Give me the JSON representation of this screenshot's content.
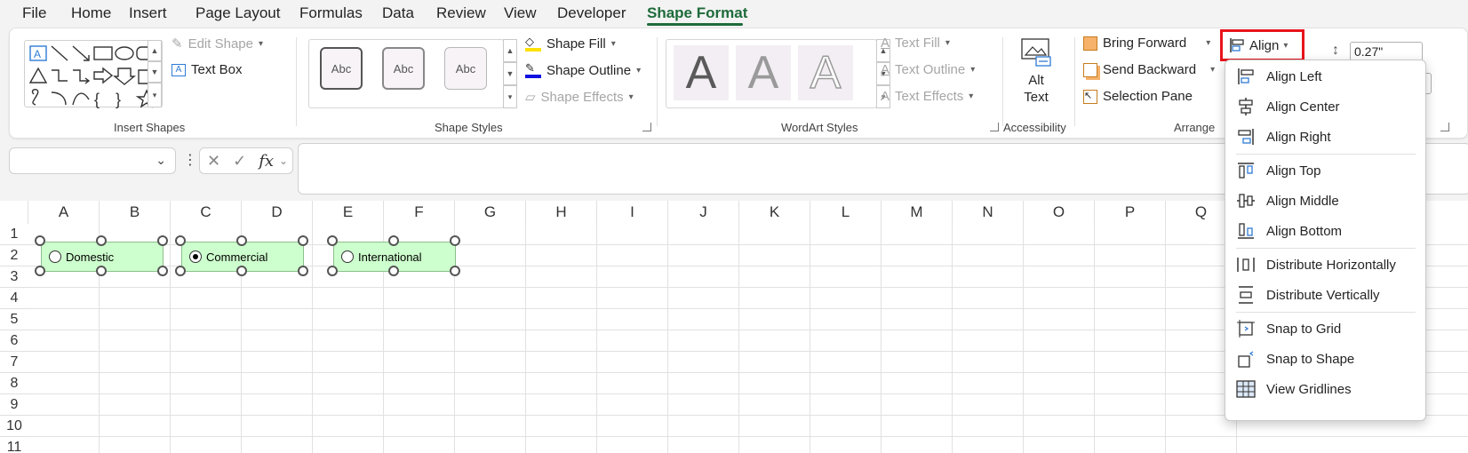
{
  "tabs": [
    "File",
    "Home",
    "Insert",
    "Page Layout",
    "Formulas",
    "Data",
    "Review",
    "View",
    "Developer",
    "Shape Format"
  ],
  "active_tab": "Shape Format",
  "ribbon": {
    "insert_shapes": {
      "edit_shape": "Edit Shape",
      "text_box": "Text Box",
      "label": "Insert Shapes"
    },
    "shape_styles": {
      "sample_label": "Abc",
      "shape_fill": "Shape Fill",
      "shape_outline": "Shape Outline",
      "shape_effects": "Shape Effects",
      "label": "Shape Styles"
    },
    "wordart": {
      "letter": "A",
      "text_fill": "Text Fill",
      "text_outline": "Text Outline",
      "text_effects": "Text Effects",
      "label": "WordArt Styles"
    },
    "accessibility": {
      "alt_text_line1": "Alt",
      "alt_text_line2": "Text",
      "label": "Accessibility"
    },
    "arrange": {
      "bring_forward": "Bring Forward",
      "send_backward": "Send Backward",
      "selection_pane": "Selection Pane",
      "align": "Align",
      "label": "Arrange"
    },
    "size": {
      "height": "0.27\""
    }
  },
  "formula_bar": {
    "fx": "fx",
    "cancel": "✕",
    "enter": "✓"
  },
  "columns": [
    "A",
    "B",
    "C",
    "D",
    "E",
    "F",
    "G",
    "H",
    "I",
    "J",
    "K",
    "L",
    "M",
    "N",
    "O",
    "P",
    "Q"
  ],
  "rows": [
    "1",
    "2",
    "3",
    "4",
    "5",
    "6",
    "7",
    "8",
    "9",
    "10",
    "11"
  ],
  "option_buttons": [
    {
      "label": "Domestic",
      "checked": false
    },
    {
      "label": "Commercial",
      "checked": true
    },
    {
      "label": "International",
      "checked": false
    }
  ],
  "align_menu": [
    {
      "label": "Align Left",
      "icon": "align-left-icon"
    },
    {
      "label": "Align Center",
      "icon": "align-center-icon"
    },
    {
      "label": "Align Right",
      "icon": "align-right-icon"
    },
    {
      "label": "Align Top",
      "icon": "align-top-icon"
    },
    {
      "label": "Align Middle",
      "icon": "align-middle-icon"
    },
    {
      "label": "Align Bottom",
      "icon": "align-bottom-icon"
    },
    {
      "label": "Distribute Horizontally",
      "icon": "distribute-horizontally-icon"
    },
    {
      "label": "Distribute Vertically",
      "icon": "distribute-vertically-icon"
    },
    {
      "label": "Snap to Grid",
      "icon": "snap-to-grid-icon"
    },
    {
      "label": "Snap to Shape",
      "icon": "snap-to-shape-icon"
    },
    {
      "label": "View Gridlines",
      "icon": "view-gridlines-icon"
    }
  ],
  "colors": {
    "accent_green": "#1e6b3a",
    "highlight_red": "#e8141b",
    "option_fill": "#cdfecd"
  }
}
